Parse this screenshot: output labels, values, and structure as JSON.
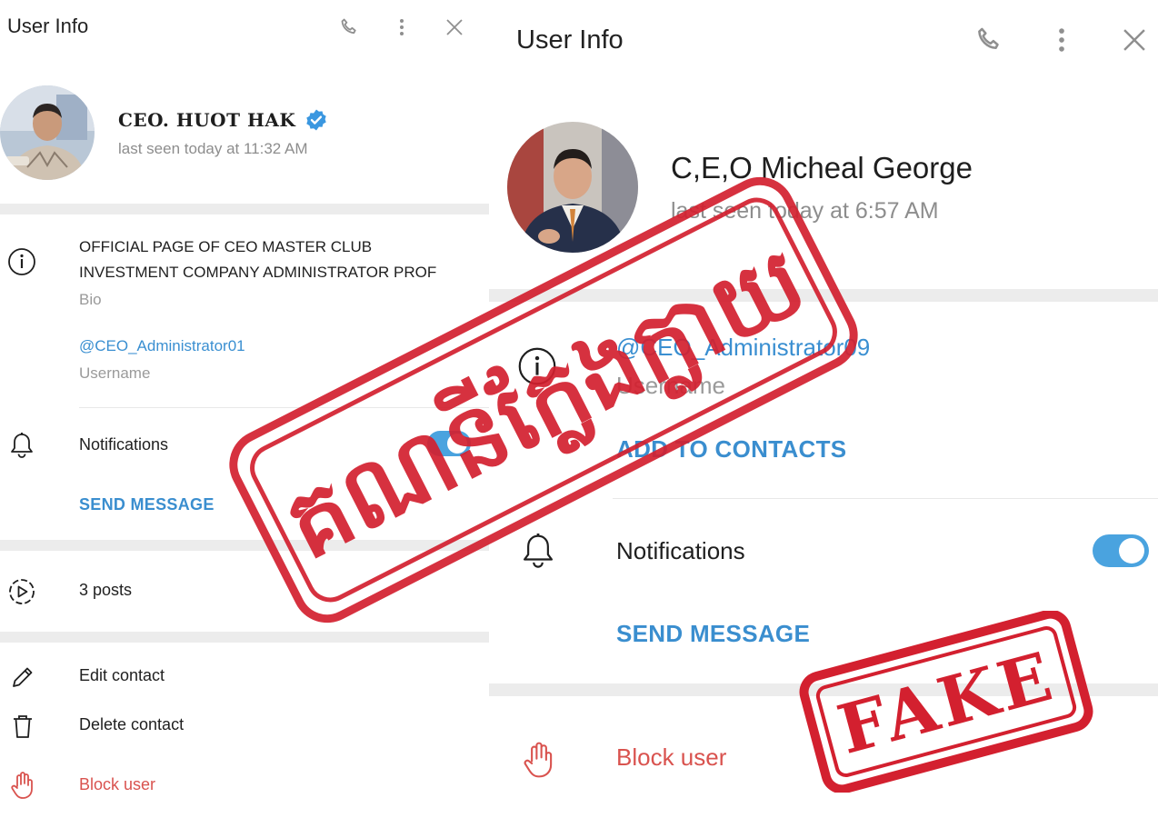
{
  "left": {
    "header": {
      "title": "User Info"
    },
    "profile": {
      "name": "CEO. HUOT HAK",
      "verified": true,
      "last_seen": "last seen today at 11:32 AM"
    },
    "bio": {
      "line1": "OFFICIAL PAGE OF CEO MASTER CLUB",
      "line2": "INVESTMENT COMPANY ADMINISTRATOR PROF",
      "label": "Bio"
    },
    "username": {
      "value": "@CEO_Administrator01",
      "label": "Username"
    },
    "notifications": {
      "label": "Notifications",
      "enabled": true
    },
    "send_message": "SEND MESSAGE",
    "posts": "3 posts",
    "edit_contact": "Edit contact",
    "delete_contact": "Delete contact",
    "block_user": "Block user"
  },
  "right": {
    "header": {
      "title": "User Info"
    },
    "profile": {
      "name": "C,E,O Micheal George",
      "last_seen": "last seen today at 6:57 AM"
    },
    "username": {
      "value": "@CEO_Administrator09",
      "label": "Username"
    },
    "add_to_contacts": "ADD TO CONTACTS",
    "notifications": {
      "label": "Notifications",
      "enabled": true
    },
    "send_message": "SEND MESSAGE",
    "block_user": "Block user"
  },
  "stamps": {
    "khmer_text": "គណនីក្លែងក្លាយ",
    "fake_text": "FAKE",
    "color": "#d3202f"
  },
  "colors": {
    "accent": "#3a8fd1",
    "danger": "#d9534f",
    "verified": "#3a97e0",
    "toggle": "#4aa3df"
  }
}
